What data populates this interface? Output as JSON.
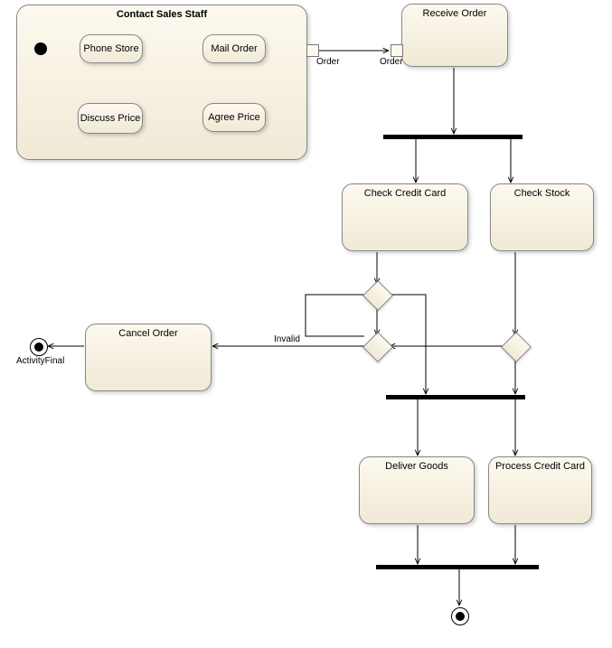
{
  "region": {
    "title": "Contact Sales Staff"
  },
  "activities": {
    "phoneStore": "Phone Store",
    "discussPrice": "Discuss Price",
    "agreePrice": "Agree Price",
    "mailOrder": "Mail Order",
    "receiveOrder": "Receive Order",
    "checkCreditCard": "Check Credit Card",
    "checkStock": "Check Stock",
    "deliverGoods": "Deliver Goods",
    "processCreditCard": "Process Credit Card",
    "cancelOrder": "Cancel Order"
  },
  "pins": {
    "mailOrderOut": "Order",
    "receiveOrderIn": "Order"
  },
  "labels": {
    "invalid": "Invalid",
    "activityFinal": "ActivityFinal"
  }
}
